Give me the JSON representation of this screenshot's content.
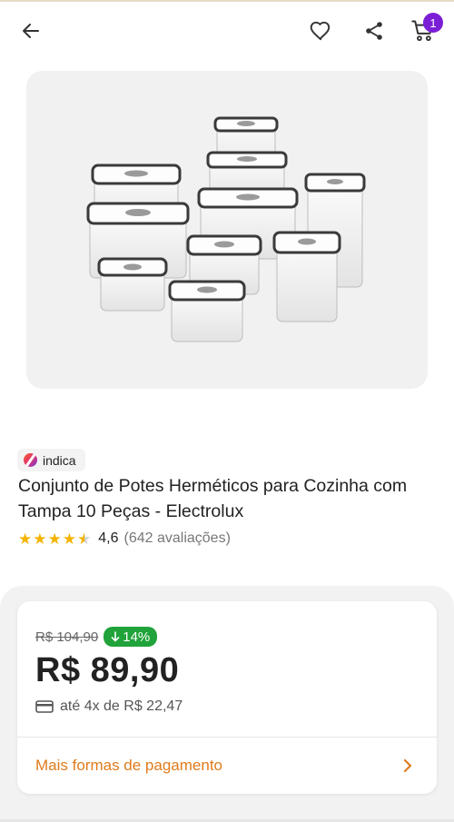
{
  "header": {
    "cart_count": "1"
  },
  "seller": {
    "name": "indica"
  },
  "product": {
    "title": "Conjunto de Potes Herméticos para Cozinha com Tampa 10 Peças - Electrolux",
    "rating": "4,6",
    "rating_value": 4.6,
    "reviews": "(642 avaliações)"
  },
  "pricing": {
    "old_price": "R$ 104,90",
    "discount": "14%",
    "price": "R$ 89,90",
    "installments": "até 4x de R$ 22,47",
    "more_payment": "Mais formas de pagamento"
  },
  "colors": {
    "badge": "#7b1fd6",
    "discount": "#20a33a",
    "link": "#e07b1c",
    "star": "#f4b400"
  }
}
